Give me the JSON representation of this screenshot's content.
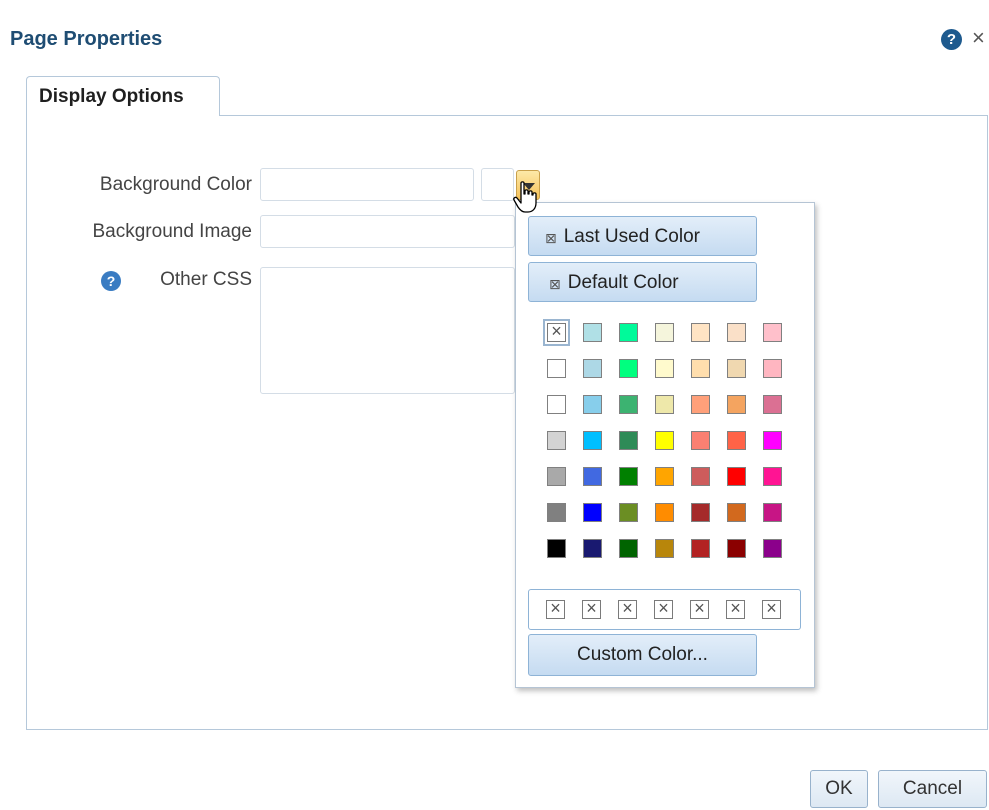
{
  "dialog": {
    "title": "Page Properties",
    "help_glyph": "?",
    "close_glyph": "×"
  },
  "tabs": [
    {
      "label": "Display Options",
      "selected": true
    }
  ],
  "form": {
    "background_color": {
      "label": "Background Color",
      "value": ""
    },
    "background_image": {
      "label": "Background Image",
      "value": ""
    },
    "other_css": {
      "label": "Other CSS",
      "value": "",
      "help_glyph": "?"
    }
  },
  "color_popup": {
    "last_used_label": "Last Used Color",
    "default_label": "Default Color",
    "custom_label": "Custom Color...",
    "no_color_glyph": "⊠",
    "swatches": [
      [
        "none",
        "#b0e0e6",
        "#00fa9a",
        "#f5f5dc",
        "#ffe4c4",
        "#fae0c8",
        "#ffc0cb"
      ],
      [
        "#ffffff",
        "#add8e6",
        "#00ff7f",
        "#fffacd",
        "#ffdead",
        "#f0d8b0",
        "#ffb6c1"
      ],
      [
        "#ffffff",
        "#87ceeb",
        "#3cb371",
        "#eee8aa",
        "#ffa07a",
        "#f4a460",
        "#db7093"
      ],
      [
        "#d3d3d3",
        "#00bfff",
        "#2e8b57",
        "#ffff00",
        "#fa8072",
        "#ff6347",
        "#ff00ff"
      ],
      [
        "#a9a9a9",
        "#4169e1",
        "#008000",
        "#ffa500",
        "#cd5c5c",
        "#ff0000",
        "#ff1493"
      ],
      [
        "#808080",
        "#0000ff",
        "#6b8e23",
        "#ff8c00",
        "#a52a2a",
        "#d2691e",
        "#c71585"
      ],
      [
        "#000000",
        "#191970",
        "#006400",
        "#b8860b",
        "#b22222",
        "#8b0000",
        "#8b008b"
      ]
    ],
    "recent_swatches": [
      "none",
      "none",
      "none",
      "none",
      "none",
      "none",
      "none"
    ]
  },
  "footer": {
    "ok_label": "OK",
    "cancel_label": "Cancel"
  },
  "colors": {
    "title": "#1f4d73",
    "accent": "#f6c35a",
    "button_blue": "#c5dbf1"
  }
}
